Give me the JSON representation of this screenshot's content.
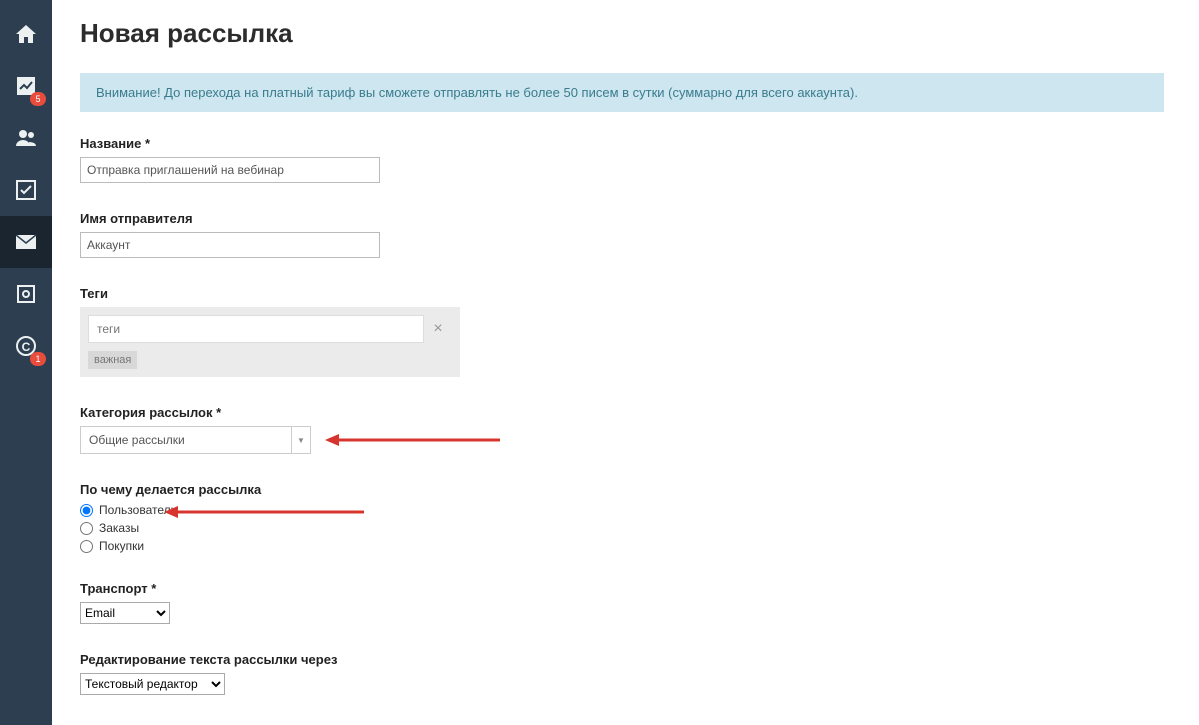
{
  "sidebar": {
    "items": [
      {
        "name": "home-icon",
        "badge": null
      },
      {
        "name": "chart-icon",
        "badge": "5"
      },
      {
        "name": "users-icon",
        "badge": null
      },
      {
        "name": "checkbox-icon",
        "badge": null
      },
      {
        "name": "mail-icon",
        "badge": null,
        "active": true
      },
      {
        "name": "safe-icon",
        "badge": null
      },
      {
        "name": "coin-icon",
        "badge": "1"
      }
    ]
  },
  "page": {
    "title": "Новая рассылка",
    "alert": "Внимание! До перехода на платный тариф вы сможете отправлять не более 50 писем в сутки (суммарно для всего аккаунта)."
  },
  "form": {
    "name_label": "Название *",
    "name_value": "Отправка приглашений на вебинар",
    "sender_label": "Имя отправителя",
    "sender_value": "Аккаунт",
    "tags_label": "Теги",
    "tags_placeholder": "теги",
    "tag_chip": "важная",
    "category_label": "Категория рассылок *",
    "category_value": "Общие рассылки",
    "target_label": "По чему делается рассылка",
    "target_options": [
      "Пользователи",
      "Заказы",
      "Покупки"
    ],
    "target_selected": 0,
    "transport_label": "Транспорт *",
    "transport_value": "Email",
    "editor_label": "Редактирование текста рассылки через",
    "editor_value": "Текстовый редактор"
  }
}
